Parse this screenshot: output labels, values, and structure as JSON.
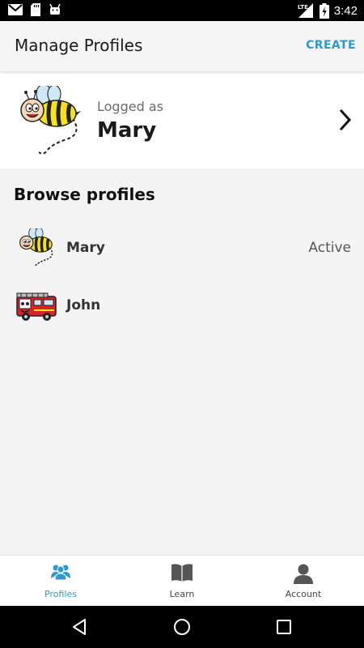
{
  "status_bar": {
    "time": "3:42",
    "network": "LTE",
    "icons": [
      "gmail-icon",
      "sd-card-icon",
      "android-icon",
      "signal-icon",
      "battery-icon"
    ]
  },
  "header": {
    "title": "Manage Profiles",
    "create_label": "CREATE"
  },
  "logged_in": {
    "caption": "Logged as",
    "name": "Mary",
    "avatar": "bee-icon"
  },
  "browse": {
    "title": "Browse profiles",
    "profiles": [
      {
        "name": "Mary",
        "status": "Active",
        "avatar": "bee-icon"
      },
      {
        "name": "John",
        "status": "",
        "avatar": "fire-truck-icon"
      }
    ]
  },
  "bottom_nav": {
    "items": [
      {
        "label": "Profiles",
        "icon": "profiles-icon",
        "active": true
      },
      {
        "label": "Learn",
        "icon": "book-icon",
        "active": false
      },
      {
        "label": "Account",
        "icon": "account-icon",
        "active": false
      }
    ]
  },
  "colors": {
    "accent": "#2a9ad0",
    "bee_yellow": "#f7e21c",
    "truck_red": "#d8232a"
  }
}
